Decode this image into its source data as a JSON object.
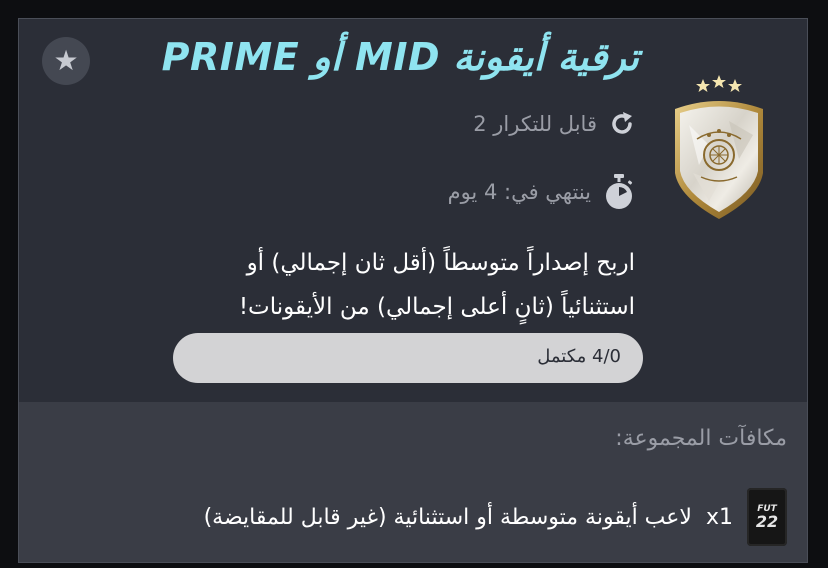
{
  "objective": {
    "title": "ترقية أيقونة MID أو PRIME",
    "favorite_icon": "star-icon",
    "repeatable": {
      "icon": "refresh-icon",
      "text": "قابل للتكرار 2"
    },
    "expiry": {
      "icon": "stopwatch-icon",
      "text": "ينتهي في: 4 يوم"
    },
    "description_line1": "اربح إصداراً متوسطاً (أقل ثان إجمالي) أو",
    "description_line2": "استثنائياً (ثانٍ أعلى إجمالي) من الأيقونات!",
    "progress": {
      "label": "4/0 مكتمل",
      "completed": 0,
      "total": 4
    }
  },
  "rewards": {
    "title": "مكافآت المجموعة:",
    "items": [
      {
        "pack_brand": "FUT",
        "pack_year": "22",
        "quantity": "x1",
        "text": "لاعب أيقونة متوسطة أو استثنائية (غير قابل للمقايضة)"
      }
    ]
  },
  "colors": {
    "accent": "#8fe4f0",
    "panel": "#2b2e37",
    "rewards_panel": "#3a3d46",
    "muted_text": "#9a9da6"
  }
}
